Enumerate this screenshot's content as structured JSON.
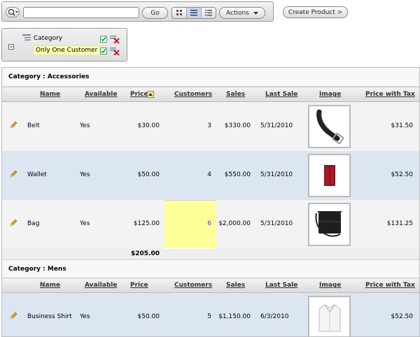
{
  "toolbar": {
    "search_value": "",
    "go_label": "Go",
    "actions_label": "Actions",
    "create_label": "Create Product >"
  },
  "filters": {
    "category_label": "Category",
    "customer_label": "Only One Customer"
  },
  "columns": [
    "Name",
    "Available",
    "Price",
    "Customers",
    "Sales",
    "Last Sale",
    "Image",
    "Price with Tax"
  ],
  "groups": [
    {
      "title": "Category : Accessories",
      "rows": [
        {
          "name": "Belt",
          "available": "Yes",
          "price": "$30.00",
          "customers": "3",
          "sales": "$330.00",
          "last_sale": "5/31/2010",
          "image": "belt",
          "price_tax": "$31.50"
        },
        {
          "name": "Wallet",
          "available": "Yes",
          "price": "$50.00",
          "customers": "4",
          "sales": "$550.00",
          "last_sale": "5/31/2010",
          "image": "wallet",
          "price_tax": "$52.50"
        },
        {
          "name": "Bag",
          "available": "Yes",
          "price": "$125.00",
          "customers": "6",
          "sales": "$2,000.00",
          "last_sale": "5/31/2010",
          "image": "bag",
          "price_tax": "$131.25"
        }
      ],
      "total_price": "$205.00"
    },
    {
      "title": "Category : Mens",
      "rows": [
        {
          "name": "Business Shirt",
          "available": "Yes",
          "price": "$50.00",
          "customers": "5",
          "sales": "$1,150.00",
          "last_sale": "6/3/2010",
          "image": "shirt",
          "price_tax": "$52.50"
        }
      ]
    }
  ],
  "colors": {
    "highlight": "#ffff99",
    "link": "#2255aa",
    "row_alt": "#dce5f2"
  }
}
